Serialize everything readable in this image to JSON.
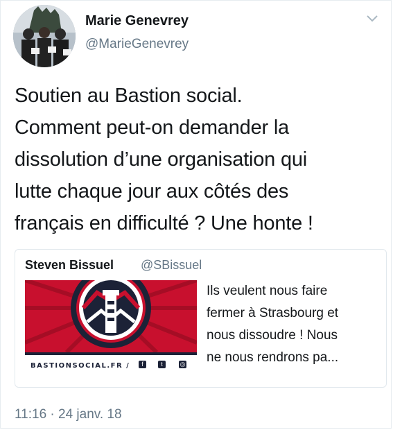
{
  "tweet": {
    "author_name": "Marie Genevrey",
    "author_handle": "@MarieGenevrey",
    "text_lines": [
      "Soutien au Bastion social.",
      "Comment peut-on demander la",
      "dissolution d’une organisation qui",
      "lutte chaque jour aux côtés des",
      "français en difficulté ? Une honte !"
    ],
    "timestamp": "11:16 · 24 janv. 18"
  },
  "quoted": {
    "author_name": "Steven Bissuel",
    "author_handle": "@SBissuel",
    "text_lines": [
      "Ils veulent nous faire",
      "fermer à Strasbourg et",
      "nous dissoudre ! Nous",
      "ne nous rendrons pa..."
    ],
    "image_caption": "BASTIONSOCIAL.FR /"
  },
  "icons": {
    "menu": "chevron-down-icon",
    "facebook": "facebook-icon",
    "twitter": "twitter-icon",
    "instagram": "instagram-icon"
  },
  "colors": {
    "text": "#14171a",
    "secondary": "#657786",
    "border": "#e1e8ed",
    "banner_red": "#c8102e",
    "banner_navy": "#1c2237"
  }
}
